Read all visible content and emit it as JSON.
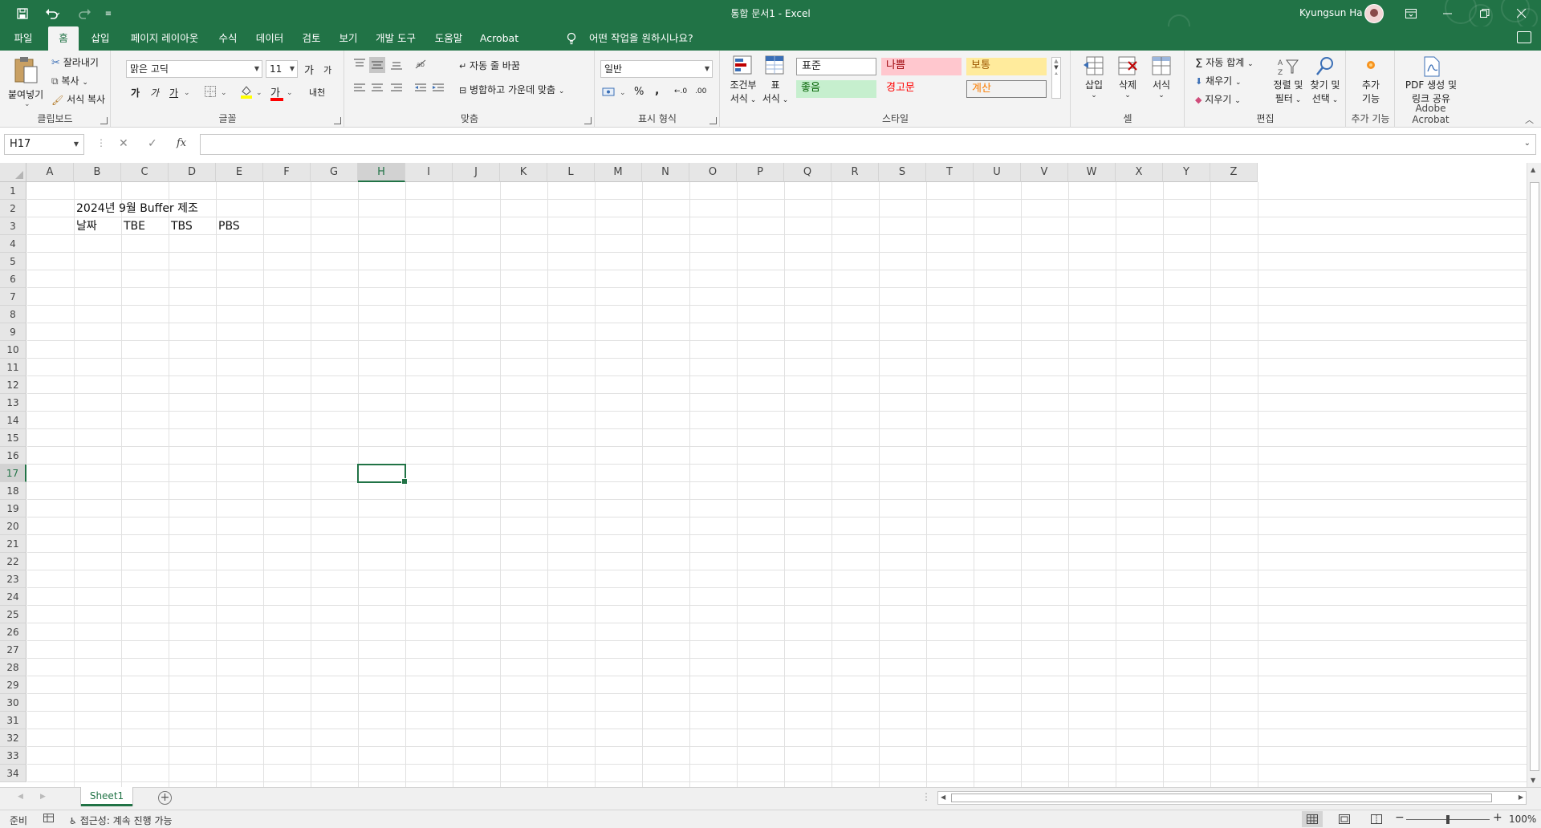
{
  "titlebar": {
    "title": "통합 문서1  -  Excel",
    "user": "Kyungsun Ha",
    "save_icon": "save-icon",
    "undo_icon": "undo-icon",
    "redo_icon": "redo-icon",
    "customize_icon": "customize-qat-icon"
  },
  "tabs": [
    "파일",
    "홈",
    "삽입",
    "페이지 레이아웃",
    "수식",
    "데이터",
    "검토",
    "보기",
    "개발 도구",
    "도움말",
    "Acrobat"
  ],
  "active_tab": "홈",
  "tellme": "어떤 작업을 원하시나요?",
  "ribbon": {
    "clipboard": {
      "paste": "붙여넣기",
      "cut": "잘라내기",
      "copy": "복사",
      "format_painter": "서식 복사",
      "label": "클립보드"
    },
    "font": {
      "name": "맑은 고딕",
      "size": "11",
      "grow": "가",
      "shrink": "가",
      "bold": "가",
      "italic": "가",
      "underline": "가",
      "font_color": "가",
      "phonetic": "내천",
      "label": "글꼴",
      "fill_color": "#ffff00",
      "text_color": "#ff0000"
    },
    "alignment": {
      "wrap": "자동 줄 바꿈",
      "merge": "병합하고 가운데 맞춤",
      "label": "맞춤"
    },
    "number": {
      "format": "일반",
      "percent": "%",
      "comma": ",",
      "inc_decimal": "←.0",
      "dec_decimal": ".00",
      "label": "표시 형식"
    },
    "styles": {
      "conditional_1": "조건부",
      "conditional_2": "서식",
      "table_1": "표",
      "table_2": "서식",
      "normal": "표준",
      "bad": "나쁨",
      "neutral": "보통",
      "good": "좋음",
      "warning": "경고문",
      "calc": "계산",
      "label": "스타일"
    },
    "cells": {
      "insert": "삽입",
      "delete": "삭제",
      "format": "서식",
      "label": "셀"
    },
    "editing": {
      "autosum": "자동 합계",
      "fill": "채우기",
      "clear": "지우기",
      "sort_1": "정렬 및",
      "sort_2": "필터",
      "find_1": "찾기 및",
      "find_2": "선택",
      "label": "편집"
    },
    "addins": {
      "btn_1": "추가",
      "btn_2": "기능",
      "label": "추가 기능"
    },
    "acrobat": {
      "btn_1": "PDF 생성 및",
      "btn_2": "링크 공유",
      "label": "Adobe Acrobat"
    }
  },
  "formula_bar": {
    "name_box": "H17",
    "cancel": "✕",
    "enter": "✓",
    "fx": "fx",
    "content": ""
  },
  "grid": {
    "columns": [
      "A",
      "B",
      "C",
      "D",
      "E",
      "F",
      "G",
      "H",
      "I",
      "J",
      "K",
      "L",
      "M",
      "N",
      "O",
      "P",
      "Q",
      "R",
      "S",
      "T",
      "U",
      "V",
      "W",
      "X",
      "Y",
      "Z"
    ],
    "rows": [
      "1",
      "2",
      "3",
      "4",
      "5",
      "6",
      "7",
      "8",
      "9",
      "10",
      "11",
      "12",
      "13",
      "14",
      "15",
      "16",
      "17",
      "18",
      "19",
      "20",
      "21",
      "22",
      "23",
      "24",
      "25",
      "26",
      "27",
      "28",
      "29",
      "30",
      "31",
      "32",
      "33",
      "34"
    ],
    "selected_cell": "H17",
    "cells": {
      "B2": "2024년 9월 Buffer 제조",
      "B3": "날짜",
      "C3": "TBE",
      "D3": "TBS",
      "E3": "PBS"
    }
  },
  "sheets": [
    "Sheet1"
  ],
  "statusbar": {
    "ready": "준비",
    "accessibility": "접근성: 계속 진행 가능",
    "zoom": "100%"
  },
  "colors": {
    "brand": "#217346",
    "bad_bg": "#ffc7ce",
    "bad_fg": "#9c0006",
    "good_bg": "#c6efce",
    "good_fg": "#006100",
    "neutral_bg": "#ffeb9c",
    "neutral_fg": "#9c5700",
    "calc_fg": "#fa7d00",
    "warning_fg": "#ff0000"
  }
}
